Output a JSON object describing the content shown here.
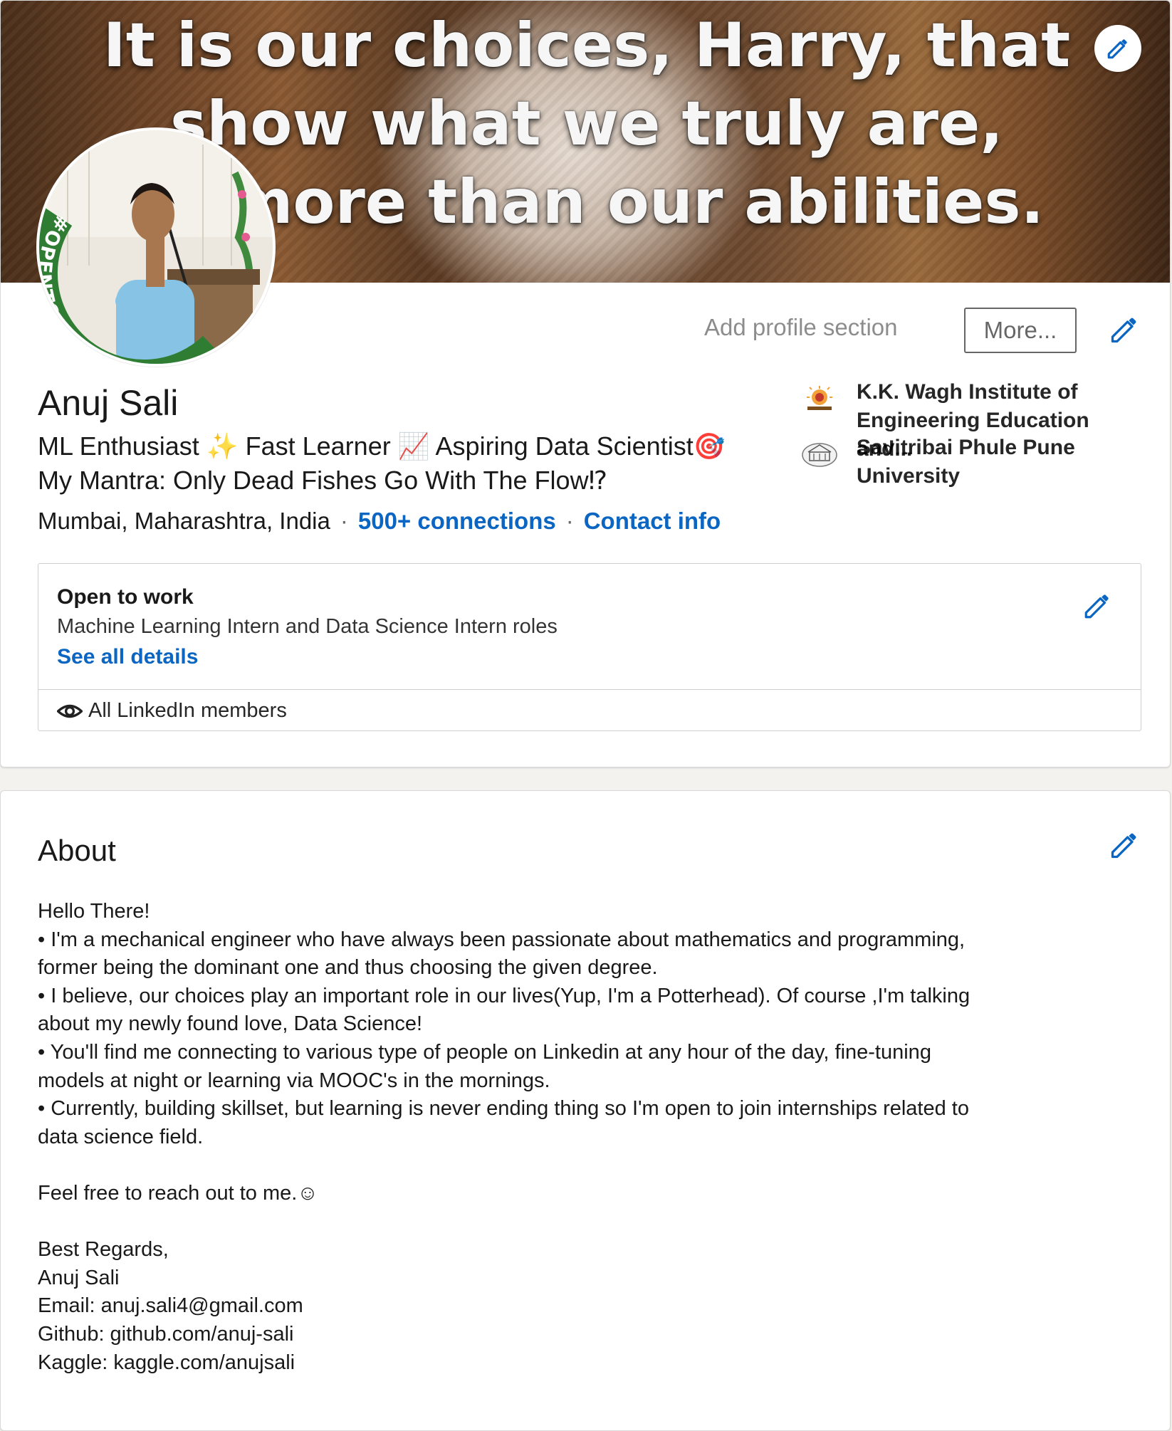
{
  "banner": {
    "quote_lines": [
      "It is our choices, Harry, that",
      "show what we truly are,",
      "more than our abilities."
    ]
  },
  "avatar": {
    "badge_text": "#OPENTOWORK"
  },
  "actions": {
    "add_profile_section": "Add profile section",
    "more": "More..."
  },
  "profile": {
    "name": "Anuj Sali",
    "headline_line1": "ML Enthusiast ✨ Fast Learner 📈 Aspiring Data Scientist🎯",
    "headline_line2": "My Mantra: Only Dead Fishes Go With The Flow⁉",
    "location": "Mumbai, Maharashtra, India",
    "connections": "500+ connections",
    "contact_info": "Contact info"
  },
  "education": [
    {
      "name": "K.K. Wagh Institute of Engineering Education and...",
      "logo_icon": "kk-wagh-logo-icon"
    },
    {
      "name": "Savitribai Phule Pune University",
      "logo_icon": "sppu-logo-icon"
    }
  ],
  "open_to_work": {
    "title": "Open to work",
    "description": "Machine Learning Intern and Data Science Intern roles",
    "see_all": "See all details",
    "visibility": "All LinkedIn members"
  },
  "about": {
    "title": "About",
    "body": "Hello There!\n• I'm a mechanical engineer who have always been passionate about mathematics and programming,\nformer being the dominant one and thus choosing the given degree.\n• I believe, our choices play an important role in our lives(Yup, I'm a Potterhead). Of course ,I'm talking\nabout my newly found love, Data Science!\n• You'll find me connecting to various type of people on Linkedin at any hour of the day, fine-tuning\nmodels at night or learning via MOOC's in the mornings.\n• Currently, building skillset, but learning is never ending thing so I'm open to join internships related to\ndata science field.\n\nFeel free to reach out to me.☺\n\nBest Regards,\nAnuj Sali\nEmail: anuj.sali4@gmail.com\nGithub: github.com/anuj-sali\nKaggle: kaggle.com/anujsali"
  },
  "colors": {
    "link_blue": "#0a66c2",
    "opentowork_green": "#2e7d32",
    "page_bg": "#f3f2ef"
  }
}
